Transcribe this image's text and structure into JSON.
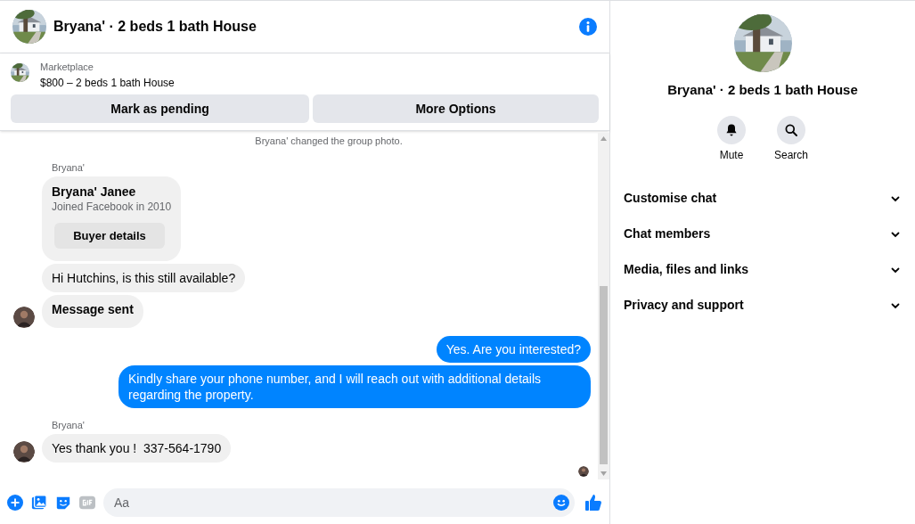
{
  "header": {
    "title": "Bryana' · 2 beds 1 bath House"
  },
  "listing": {
    "source": "Marketplace",
    "title": "$800 – 2 beds 1 bath House",
    "buttons": [
      "Mark as pending",
      "More Options"
    ]
  },
  "messages": [
    {
      "kind": "system",
      "text": "Bryana' changed the group photo."
    },
    {
      "kind": "sender",
      "text": "Bryana'"
    },
    {
      "kind": "card",
      "name": "Bryana' Janee",
      "subtitle": "Joined Facebook in 2010",
      "button": "Buyer details"
    },
    {
      "kind": "incoming",
      "text": "Hi Hutchins, is this still available?",
      "avatar": false,
      "emphasis": false
    },
    {
      "kind": "incoming",
      "text": "Message sent",
      "avatar": true,
      "emphasis": true
    },
    {
      "kind": "outgoing",
      "text": "Yes. Are you interested?"
    },
    {
      "kind": "outgoing",
      "text": "Kindly share your phone number, and I will reach out with additional details regarding the property."
    },
    {
      "kind": "sender",
      "text": "Bryana'"
    },
    {
      "kind": "incoming",
      "text": "Yes thank you !  337-564-1790",
      "avatar": true,
      "emphasis": false
    },
    {
      "kind": "seen"
    }
  ],
  "composer": {
    "placeholder": "Aa"
  },
  "profile": {
    "title": "Bryana' · 2 beds 1 bath House",
    "actions": [
      {
        "label": "Mute"
      },
      {
        "label": "Search"
      }
    ],
    "sections": [
      {
        "label": "Customise chat",
        "expanded": false
      },
      {
        "label": "Chat members",
        "expanded": false
      },
      {
        "label": "Media, files and links",
        "expanded": false
      },
      {
        "label": "Privacy and support",
        "expanded": false
      }
    ]
  }
}
